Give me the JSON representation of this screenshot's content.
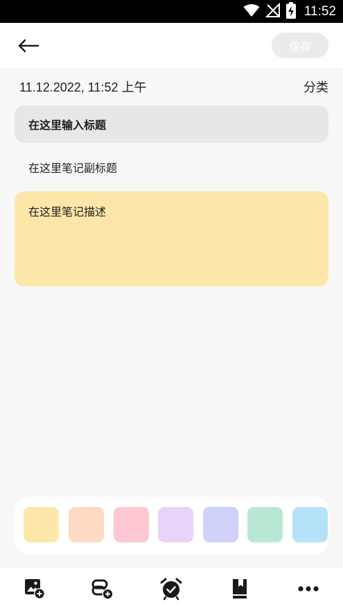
{
  "status_bar": {
    "time": "11:52",
    "icons": [
      "wifi-icon",
      "no-signal-icon",
      "battery-charging-icon"
    ]
  },
  "app_bar": {
    "back_icon": "arrow-left-icon",
    "save_label": "保存"
  },
  "note": {
    "datetime": "11.12.2022, 11:52 上午",
    "category_label": "分类",
    "title_placeholder": "在这里输入标题",
    "subtitle_placeholder": "在这里笔记副标题",
    "description_placeholder": "在这里笔记描述"
  },
  "colors": {
    "selected": "#fde6a9",
    "palette": [
      "#fde6a9",
      "#fed9c4",
      "#fdc8d2",
      "#e7d2f8",
      "#cfd1fb",
      "#b8e8d4",
      "#b5e2f8"
    ]
  },
  "toolbar": {
    "items": [
      "add-image-icon",
      "add-link-icon",
      "alarm-icon",
      "bookmark-icon",
      "more-icon"
    ]
  }
}
